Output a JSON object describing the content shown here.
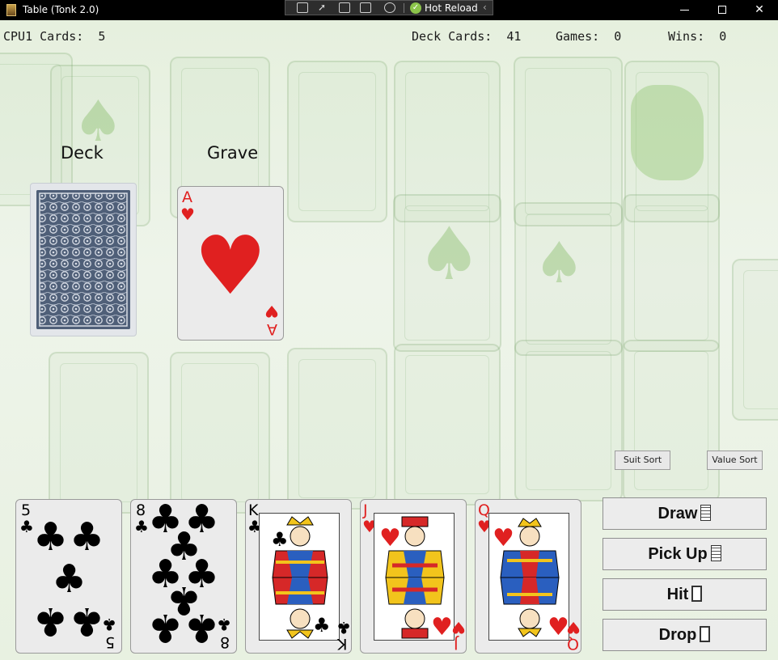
{
  "window": {
    "title": "Table (Tonk 2.0)",
    "devtools_label": "Hot Reload",
    "controls": {
      "minimize": "",
      "maximize": "",
      "close": "✕"
    }
  },
  "status": {
    "cpu_cards": "CPU1 Cards:  5",
    "deck_cards": "Deck Cards:  41",
    "games": "Games:  0",
    "wins": "Wins:  0"
  },
  "piles": {
    "deck_label": "Deck",
    "grave_label": "Grave",
    "grave_card": {
      "rank": "A",
      "suit": "♥",
      "color": "#e02020"
    }
  },
  "hand": [
    {
      "rank": "5",
      "suit": "♣",
      "color": "#000000"
    },
    {
      "rank": "8",
      "suit": "♣",
      "color": "#000000"
    },
    {
      "rank": "K",
      "suit": "♣",
      "color": "#000000"
    },
    {
      "rank": "J",
      "suit": "♥",
      "color": "#e02020"
    },
    {
      "rank": "Q",
      "suit": "♥",
      "color": "#e02020"
    }
  ],
  "sort_buttons": {
    "suit": "Suit Sort",
    "value": "Value Sort"
  },
  "actions": {
    "draw": "Draw",
    "pickup": "Pick Up",
    "hit": "Hit",
    "drop": "Drop"
  }
}
